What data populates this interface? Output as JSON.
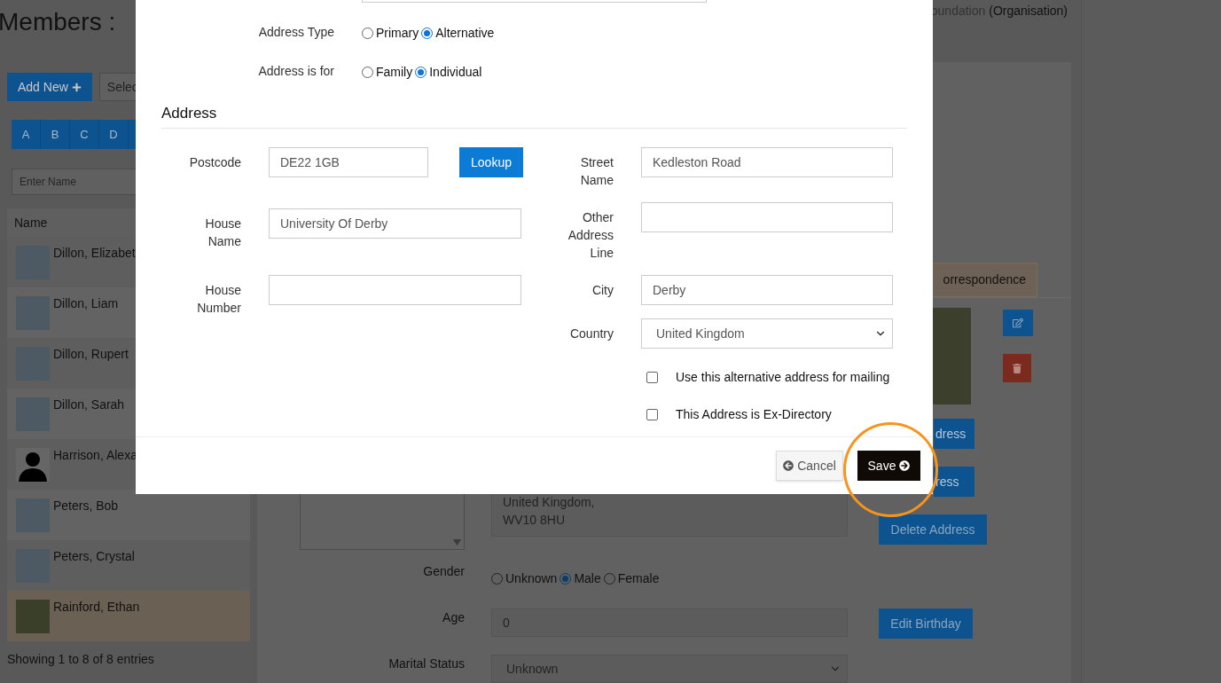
{
  "page": {
    "title": "Members :",
    "organisation": {
      "name": "oundation",
      "type": "(Organisation)"
    }
  },
  "sidebar": {
    "add_button": "Add New",
    "select": {
      "value": "Selec"
    },
    "letters": [
      {
        "label": "A"
      },
      {
        "label": "B"
      },
      {
        "label": "C"
      },
      {
        "label": "D"
      }
    ],
    "search": {
      "placeholder": "Enter Name"
    },
    "column": "Name",
    "rows": [
      {
        "name": "Dillon, Elizabet",
        "kind": "photo",
        "selected": false
      },
      {
        "name": "Dillon, Liam",
        "kind": "photo",
        "selected": false
      },
      {
        "name": "Dillon, Rupert",
        "kind": "photo",
        "selected": false
      },
      {
        "name": "Dillon, Sarah",
        "kind": "photo",
        "selected": false
      },
      {
        "name": "Harrison, Alexa",
        "kind": "silhouette",
        "selected": false
      },
      {
        "name": "Peters, Bob",
        "kind": "photo",
        "selected": false
      },
      {
        "name": "Peters, Crystal",
        "kind": "photo",
        "selected": false
      },
      {
        "name": "Rainford, Ethan",
        "kind": "photo",
        "selected": true
      }
    ],
    "footer": "Showing 1 to 8 of 8 entries"
  },
  "profile": {
    "tab": {
      "label": "orrespondence",
      "selected": true
    },
    "address_buttons": [
      "dress",
      "ress",
      "Delete Address"
    ],
    "address_lines": [
      "United Kingdom,",
      "WV10 8HU"
    ],
    "gender": {
      "label": "Gender",
      "options": [
        {
          "label": "Unknown",
          "selected": false
        },
        {
          "label": "Male",
          "selected": true
        },
        {
          "label": "Female",
          "selected": false
        }
      ]
    },
    "age": {
      "label": "Age",
      "value": "0",
      "button": "Edit Birthday"
    },
    "marital_status": {
      "label": "Marital Status",
      "value": "Unknown"
    }
  },
  "modal": {
    "address_type": {
      "label": "Address Type",
      "options": [
        {
          "label": "Primary",
          "selected": false
        },
        {
          "label": "Alternative",
          "selected": true
        }
      ]
    },
    "address_for": {
      "label": "Address is for",
      "options": [
        {
          "label": "Family",
          "selected": false
        },
        {
          "label": "Individual",
          "selected": true
        }
      ]
    },
    "section_title": "Address",
    "left_fields": [
      {
        "label": "Postcode",
        "value": "DE22 1GB",
        "kind": "postcode"
      },
      {
        "label": "House Name",
        "value": "University Of Derby",
        "kind": "text"
      },
      {
        "label": "House Number",
        "kind": "text"
      }
    ],
    "lookup_button": "Lookup",
    "right_fields": [
      {
        "label": "Street Name",
        "value": "Kedleston Road",
        "kind": "text"
      },
      {
        "label": "Other Address Line",
        "kind": "text"
      },
      {
        "label": "City",
        "value": "Derby",
        "kind": "text"
      },
      {
        "label": "Country",
        "value": "United Kingdom",
        "kind": "select"
      }
    ],
    "checkboxes": [
      {
        "label": "Use this alternative address for mailing",
        "checked": false
      },
      {
        "label": "This Address is Ex-Directory",
        "checked": false
      }
    ],
    "cancel_button": "Cancel",
    "save_button": "Save"
  }
}
